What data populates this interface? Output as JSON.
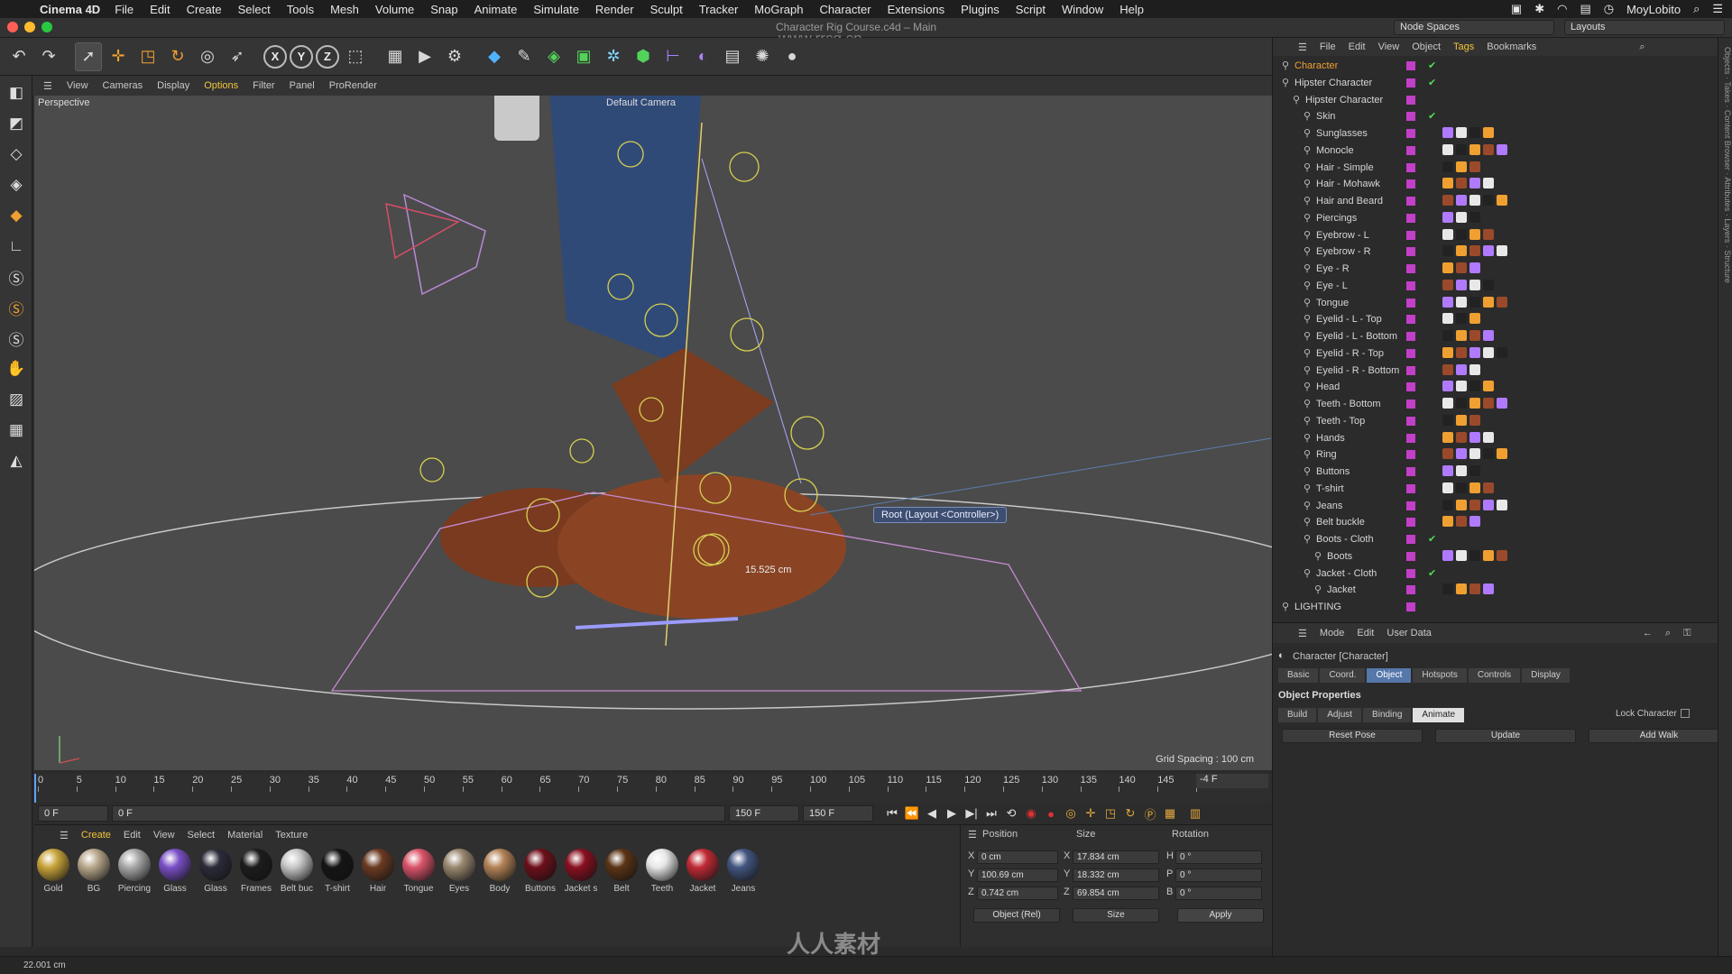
{
  "mac_menu": {
    "app": "Cinema 4D",
    "items": [
      "File",
      "Edit",
      "Create",
      "Select",
      "Tools",
      "Mesh",
      "Volume",
      "Snap",
      "Animate",
      "Simulate",
      "Render",
      "Sculpt",
      "Tracker",
      "MoGraph",
      "Character",
      "Extensions",
      "Plugins",
      "Script",
      "Window",
      "Help"
    ],
    "user": "MoyLobito"
  },
  "window": {
    "title": "Character Rig Course.c4d – Main",
    "node_spaces": "Node Spaces",
    "layouts": "Layouts"
  },
  "viewport_menu": {
    "items": [
      "View",
      "Cameras",
      "Display",
      "Options",
      "Filter",
      "Panel",
      "ProRender"
    ],
    "active": "Options"
  },
  "viewport": {
    "label": "Perspective",
    "camera": "Default Camera",
    "grid_spacing": "Grid Spacing : 100 cm",
    "tooltip": "Root (Layout <Controller>)",
    "measurement": "15.525 cm"
  },
  "timeline": {
    "ticks": [
      "0",
      "5",
      "10",
      "15",
      "20",
      "25",
      "30",
      "35",
      "40",
      "45",
      "50",
      "55",
      "60",
      "65",
      "70",
      "75",
      "80",
      "85",
      "90",
      "95",
      "100",
      "105",
      "110",
      "115",
      "120",
      "125",
      "130",
      "135",
      "140",
      "145",
      "150"
    ],
    "current_frame_right": "-4 F",
    "start_field": "0 F",
    "min_field": "0 F",
    "end_field": "150 F",
    "max_field": "150 F"
  },
  "materials": {
    "menu": [
      "Create",
      "Edit",
      "View",
      "Select",
      "Material",
      "Texture"
    ],
    "active_menu": "Create",
    "items": [
      {
        "name": "Gold",
        "color": "#c9a43a"
      },
      {
        "name": "BG",
        "color": "#b9a88c"
      },
      {
        "name": "Piercing",
        "color": "#a9a9a9"
      },
      {
        "name": "Glass",
        "color": "#7a4fc6"
      },
      {
        "name": "Glass",
        "color": "#2c2c3a"
      },
      {
        "name": "Frames",
        "color": "#1c1c1c"
      },
      {
        "name": "Belt buc",
        "color": "#c8c8c8"
      },
      {
        "name": "T-shirt",
        "color": "#151515"
      },
      {
        "name": "Hair",
        "color": "#6b3a22"
      },
      {
        "name": "Tongue",
        "color": "#d9546a"
      },
      {
        "name": "Eyes",
        "color": "#9a8870"
      },
      {
        "name": "Body",
        "color": "#b38357"
      },
      {
        "name": "Buttons",
        "color": "#6e0f1a"
      },
      {
        "name": "Jacket s",
        "color": "#8a1020"
      },
      {
        "name": "Belt",
        "color": "#5b3416"
      },
      {
        "name": "Teeth",
        "color": "#e7e7e7"
      },
      {
        "name": "Jacket",
        "color": "#c02a35"
      },
      {
        "name": "Jeans",
        "color": "#425580"
      }
    ]
  },
  "coords": {
    "headers": [
      "Position",
      "Size",
      "Rotation"
    ],
    "rows": [
      {
        "axis": "X",
        "pos": "0 cm",
        "saxis": "X",
        "size": "17.834 cm",
        "raxis": "H",
        "rot": "0 °"
      },
      {
        "axis": "Y",
        "pos": "100.69 cm",
        "saxis": "Y",
        "size": "18.332 cm",
        "raxis": "P",
        "rot": "0 °"
      },
      {
        "axis": "Z",
        "pos": "0.742 cm",
        "saxis": "Z",
        "size": "69.854 cm",
        "raxis": "B",
        "rot": "0 °"
      }
    ],
    "mode": "Object (Rel)",
    "size_mode": "Size",
    "apply": "Apply"
  },
  "object_manager": {
    "menu": [
      "File",
      "Edit",
      "View",
      "Object",
      "Tags",
      "Bookmarks"
    ],
    "active_menu": "Tags",
    "objects": [
      {
        "name": "Character",
        "indent": 0,
        "highlight": true,
        "check": "✔"
      },
      {
        "name": "Hipster Character",
        "indent": 0,
        "check": "✔"
      },
      {
        "name": "Hipster Character",
        "indent": 1,
        "check": ""
      },
      {
        "name": "Skin",
        "indent": 2,
        "check": "✔"
      },
      {
        "name": "Sunglasses",
        "indent": 2,
        "check": ""
      },
      {
        "name": "Monocle",
        "indent": 2,
        "check": ""
      },
      {
        "name": "Hair - Simple",
        "indent": 2,
        "check": ""
      },
      {
        "name": "Hair - Mohawk",
        "indent": 2,
        "check": ""
      },
      {
        "name": "Hair and Beard",
        "indent": 2,
        "check": ""
      },
      {
        "name": "Piercings",
        "indent": 2,
        "check": ""
      },
      {
        "name": "Eyebrow - L",
        "indent": 2,
        "check": ""
      },
      {
        "name": "Eyebrow - R",
        "indent": 2,
        "check": ""
      },
      {
        "name": "Eye - R",
        "indent": 2,
        "check": ""
      },
      {
        "name": "Eye - L",
        "indent": 2,
        "check": ""
      },
      {
        "name": "Tongue",
        "indent": 2,
        "check": ""
      },
      {
        "name": "Eyelid - L - Top",
        "indent": 2,
        "check": ""
      },
      {
        "name": "Eyelid - L - Bottom",
        "indent": 2,
        "check": ""
      },
      {
        "name": "Eyelid - R - Top",
        "indent": 2,
        "check": ""
      },
      {
        "name": "Eyelid - R - Bottom",
        "indent": 2,
        "check": ""
      },
      {
        "name": "Head",
        "indent": 2,
        "check": ""
      },
      {
        "name": "Teeth - Bottom",
        "indent": 2,
        "check": ""
      },
      {
        "name": "Teeth - Top",
        "indent": 2,
        "check": ""
      },
      {
        "name": "Hands",
        "indent": 2,
        "check": ""
      },
      {
        "name": "Ring",
        "indent": 2,
        "check": ""
      },
      {
        "name": "Buttons",
        "indent": 2,
        "check": ""
      },
      {
        "name": "T-shirt",
        "indent": 2,
        "check": ""
      },
      {
        "name": "Jeans",
        "indent": 2,
        "check": ""
      },
      {
        "name": "Belt buckle",
        "indent": 2,
        "check": ""
      },
      {
        "name": "Boots - Cloth",
        "indent": 2,
        "check": "✔"
      },
      {
        "name": "Boots",
        "indent": 3,
        "check": ""
      },
      {
        "name": "Jacket - Cloth",
        "indent": 2,
        "check": "✔"
      },
      {
        "name": "Jacket",
        "indent": 3,
        "check": ""
      },
      {
        "name": "LIGHTING",
        "indent": 0,
        "check": ""
      }
    ]
  },
  "attributes": {
    "menu": [
      "Mode",
      "Edit",
      "User Data"
    ],
    "title": "Character [Character]",
    "tabs": [
      "Basic",
      "Coord.",
      "Object",
      "Hotspots",
      "Controls",
      "Display"
    ],
    "active_tab": "Object",
    "section": "Object Properties",
    "subtabs": [
      "Build",
      "Adjust",
      "Binding",
      "Animate"
    ],
    "active_subtab": "Animate",
    "lock_label": "Lock Character",
    "buttons": [
      "Reset Pose",
      "Update",
      "Add Walk"
    ]
  },
  "status": {
    "text": "22.001 cm"
  },
  "side_tabs": "Objects · Takes · Content Browser · Attributes · Layers · Structure",
  "watermark": "人人素材",
  "watermark_top": "www.rrcg.cn"
}
